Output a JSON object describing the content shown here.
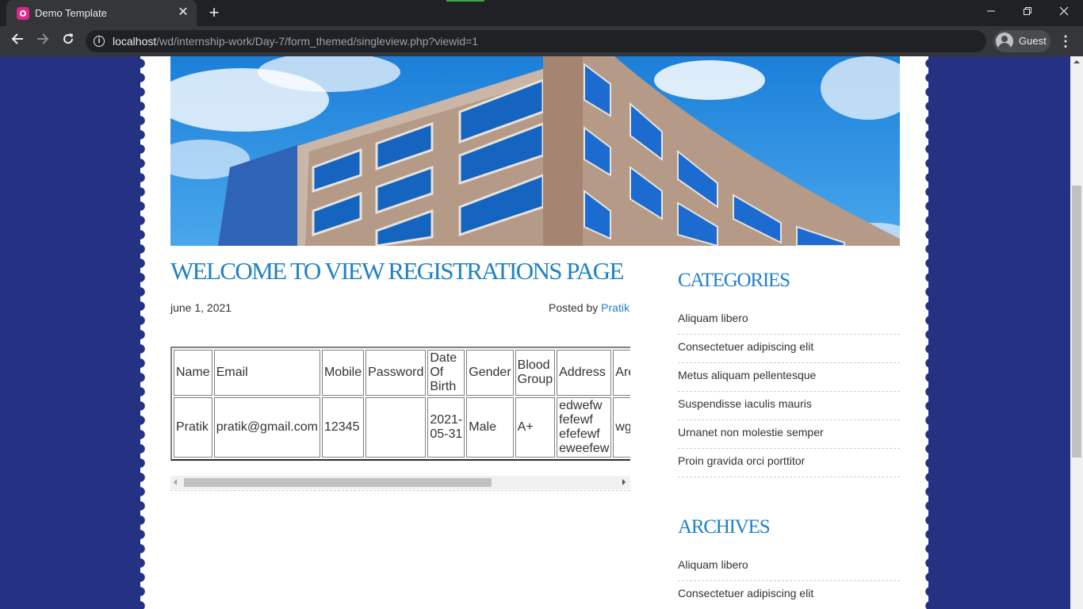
{
  "browser": {
    "tab_title": "Demo Template",
    "tab_close_glyph": "✕",
    "new_tab_glyph": "+",
    "url_host": "localhost",
    "url_path": "/wd/internship-work/Day-7/form_themed/singleview.php?viewid=1",
    "profile_label": "Guest",
    "icons": [
      "back-arrow-icon",
      "forward-arrow-icon",
      "reload-icon",
      "info-icon",
      "profile-icon",
      "menu-icon",
      "minimize-icon",
      "restore-icon",
      "close-icon"
    ]
  },
  "post": {
    "title": "WELCOME TO VIEW REGISTRATIONS PAGE",
    "date": "june 1, 2021",
    "posted_by_prefix": "Posted by",
    "author": "Pratik"
  },
  "registrations": {
    "headers": [
      "Name",
      "Email",
      "Mobile",
      "Password",
      "Date\nOf\nBirth",
      "Gender",
      "Blood\nGroup",
      "Address",
      "Area"
    ],
    "rows": [
      [
        "Pratik",
        "pratik@gmail.com",
        "12345",
        "",
        "2021-\n05-31",
        "Male",
        "A+",
        "edwefw\nfefewf\nefefewf\neweefew",
        "wgfw"
      ]
    ]
  },
  "sidebar": {
    "categories_title": "CATEGORIES",
    "categories": [
      "Aliquam libero",
      "Consectetuer adipiscing elit",
      "Metus aliquam pellentesque",
      "Suspendisse iaculis mauris",
      "Urnanet non molestie semper",
      "Proin gravida orci porttitor"
    ],
    "archives_title": "ARCHIVES",
    "archives": [
      "Aliquam libero",
      "Consectetuer adipiscing elit"
    ]
  },
  "colors": {
    "page_background": "#253283",
    "accent": "#1f81c6",
    "chrome_dark": "#202124",
    "chrome_toolbar": "#35363a"
  }
}
